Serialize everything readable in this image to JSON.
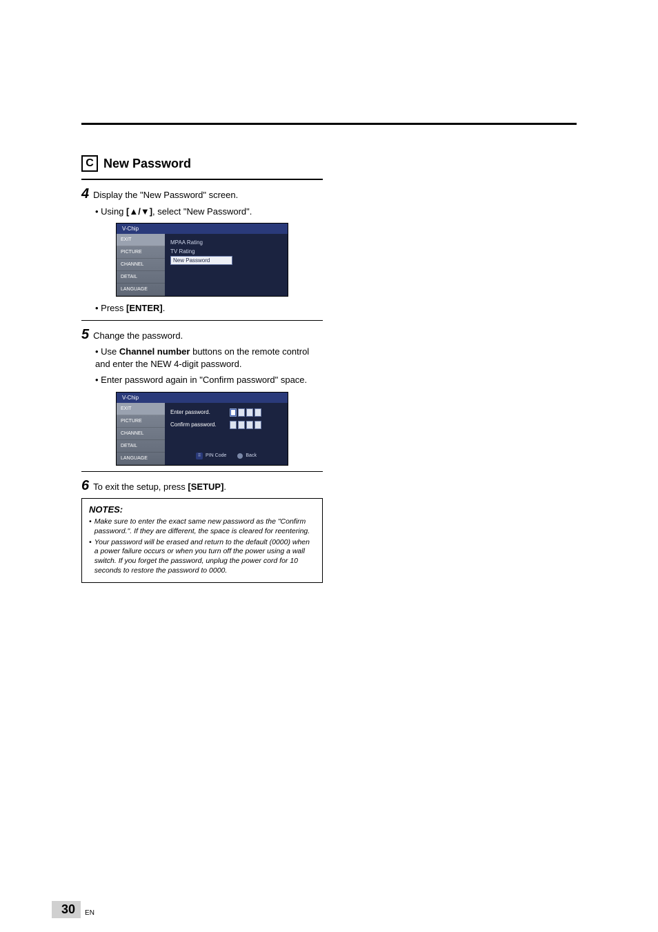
{
  "section": {
    "letter": "C",
    "title": "New Password"
  },
  "step4": {
    "num": "4",
    "text": "Display the \"New Password\" screen.",
    "bullet_prefix": "• Using ",
    "bullet_keys": "[▲/▼]",
    "bullet_suffix": ", select \"New Password\"."
  },
  "osd1": {
    "title": "V-Chip",
    "left": [
      "EXIT",
      "PICTURE",
      "CHANNEL",
      "DETAIL",
      "LANGUAGE"
    ],
    "right": {
      "r1": "MPAA Rating",
      "r2": "TV Rating",
      "sel": "New Password"
    }
  },
  "press_enter": {
    "prefix": "• Press ",
    "key": "[ENTER]",
    "suffix": "."
  },
  "step5": {
    "num": "5",
    "text": "Change the password.",
    "b1_prefix": "• Use ",
    "b1_bold": "Channel number",
    "b1_suffix": " buttons on the remote control and enter the NEW 4-digit password.",
    "b2": "• Enter password again in \"Confirm password\" space."
  },
  "osd2": {
    "title": "V-Chip",
    "left": [
      "EXIT",
      "PICTURE",
      "CHANNEL",
      "DETAIL",
      "LANGUAGE"
    ],
    "enter_label": "Enter password.",
    "confirm_label": "Confirm password.",
    "foot1": "PIN Code",
    "foot2": "Back"
  },
  "step6": {
    "num": "6",
    "prefix": "To exit the setup, press ",
    "key": "[SETUP]",
    "suffix": "."
  },
  "notes": {
    "title": "NOTES:",
    "n1": "Make sure to enter the exact same new password as the \"Confirm password.\". If they are different, the space is cleared for reentering.",
    "n2": "Your password will be erased and return to the default (0000) when a power failure occurs or when you turn off the power using a wall switch. If you forget the password, unplug the power cord for 10 seconds to restore the password to 0000."
  },
  "footer": {
    "page": "30",
    "lang": "EN"
  }
}
